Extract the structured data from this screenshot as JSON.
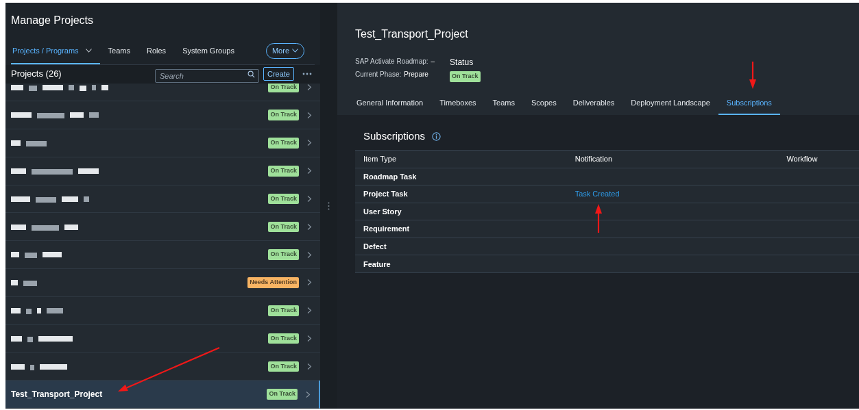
{
  "sidebar": {
    "title": "Manage Projects",
    "tabs": [
      {
        "label": "Projects / Programs",
        "selected": true,
        "dropdown": true
      },
      {
        "label": "Teams",
        "selected": false,
        "dropdown": false
      },
      {
        "label": "Roles",
        "selected": false,
        "dropdown": false
      },
      {
        "label": "System Groups",
        "selected": false,
        "dropdown": false
      }
    ],
    "more_button": "More",
    "list_title": "Projects (26)",
    "search": {
      "placeholder": "Search"
    },
    "create_button": "Create",
    "projects": [
      {
        "kind": "redacted",
        "status": "On Track",
        "color": "#9fe09a",
        "selected": false
      },
      {
        "kind": "redacted",
        "status": "On Track",
        "color": "#9fe09a",
        "selected": false
      },
      {
        "kind": "redacted",
        "status": "On Track",
        "color": "#9fe09a",
        "selected": false
      },
      {
        "kind": "redacted",
        "status": "On Track",
        "color": "#9fe09a",
        "selected": false
      },
      {
        "kind": "redacted",
        "status": "On Track",
        "color": "#9fe09a",
        "selected": false
      },
      {
        "kind": "redacted",
        "status": "On Track",
        "color": "#9fe09a",
        "selected": false
      },
      {
        "kind": "redacted",
        "status": "On Track",
        "color": "#9fe09a",
        "selected": false
      },
      {
        "kind": "redacted",
        "status": "Needs Attention",
        "color": "#f8b463",
        "selected": false
      },
      {
        "kind": "redacted",
        "status": "On Track",
        "color": "#9fe09a",
        "selected": false
      },
      {
        "kind": "redacted",
        "status": "On Track",
        "color": "#9fe09a",
        "selected": false
      },
      {
        "kind": "redacted",
        "status": "On Track",
        "color": "#9fe09a",
        "selected": false
      },
      {
        "kind": "named",
        "name": "Test_Transport_Project",
        "status": "On Track",
        "color": "#9fe09a",
        "selected": true
      }
    ]
  },
  "detail": {
    "title": "Test_Transport_Project",
    "fields": [
      {
        "label": "SAP Activate Roadmap:",
        "value": "–"
      },
      {
        "label": "Current Phase:",
        "value": "Prepare"
      }
    ],
    "status": {
      "label": "Status",
      "value": "On Track",
      "color": "#9fe09a"
    },
    "tabs": [
      {
        "label": "General Information",
        "selected": false
      },
      {
        "label": "Timeboxes",
        "selected": false
      },
      {
        "label": "Teams",
        "selected": false
      },
      {
        "label": "Scopes",
        "selected": false
      },
      {
        "label": "Deliverables",
        "selected": false
      },
      {
        "label": "Deployment Landscape",
        "selected": false
      },
      {
        "label": "Subscriptions",
        "selected": true
      }
    ],
    "section_title": "Subscriptions",
    "table": {
      "columns": [
        "Item Type",
        "Notification",
        "Workflow"
      ],
      "rows": [
        [
          "Roadmap Task",
          "",
          ""
        ],
        [
          "Project Task",
          "Task Created",
          ""
        ],
        [
          "User Story",
          "",
          ""
        ],
        [
          "Requirement",
          "",
          ""
        ],
        [
          "Defect",
          "",
          ""
        ],
        [
          "Feature",
          "",
          ""
        ]
      ]
    }
  },
  "annotations": [
    {
      "kind": "arrow"
    },
    {
      "kind": "arrow"
    },
    {
      "kind": "arrow"
    }
  ]
}
